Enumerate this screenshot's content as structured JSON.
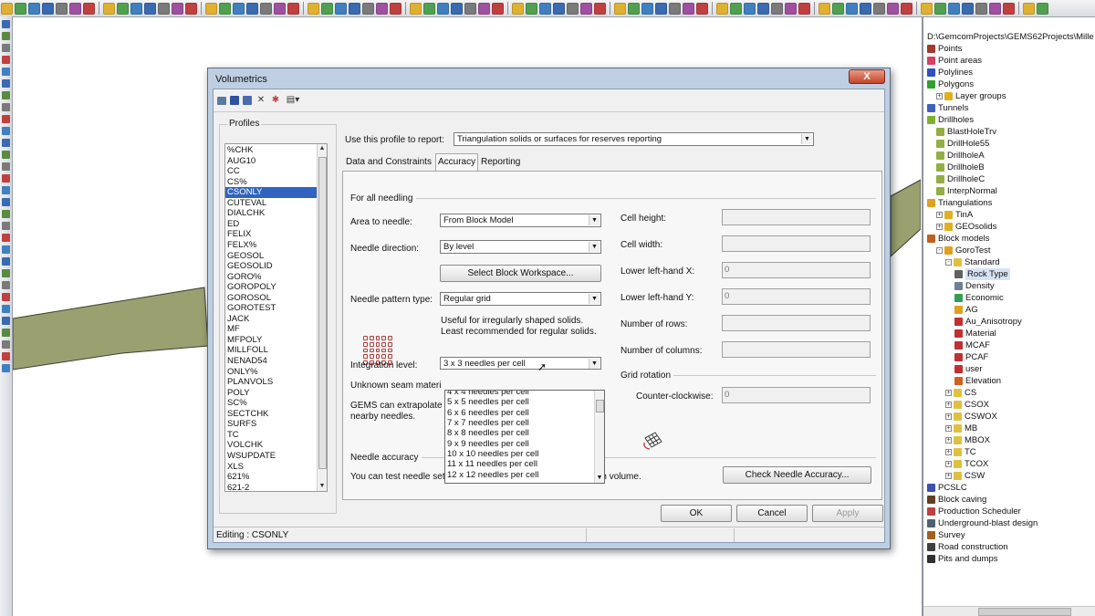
{
  "workspace": {
    "colors": {
      "surface_fill": "#9aa070",
      "surface_edge": "#3a4030"
    }
  },
  "right_panel": {
    "path": "D:\\GemcomProjects\\GEMS62Projects\\Mille",
    "tree": [
      {
        "label": "Points",
        "depth": 0,
        "icon": "points-icon",
        "color": "#a23a2a"
      },
      {
        "label": "Point areas",
        "depth": 0,
        "icon": "point-areas-icon",
        "color": "#d84060"
      },
      {
        "label": "Polylines",
        "depth": 0,
        "icon": "polylines-icon",
        "color": "#3050c0"
      },
      {
        "label": "Polygons",
        "depth": 0,
        "icon": "polygons-icon",
        "color": "#30a030"
      },
      {
        "label": "Layer groups",
        "depth": 1,
        "icon": "folder-icon",
        "color": "#e0b020",
        "expander": "+"
      },
      {
        "label": "Tunnels",
        "depth": 0,
        "icon": "tunnels-icon",
        "color": "#4060c0"
      },
      {
        "label": "Drillholes",
        "depth": 0,
        "icon": "drillholes-icon",
        "color": "#80b030"
      },
      {
        "label": "BlastHoleTrv",
        "depth": 1,
        "icon": "drillhole-table-icon",
        "color": "#90b040"
      },
      {
        "label": "DrillHole55",
        "depth": 1,
        "icon": "drillhole-table-icon",
        "color": "#90b040"
      },
      {
        "label": "DrillholeA",
        "depth": 1,
        "icon": "drillhole-table-icon",
        "color": "#90b040"
      },
      {
        "label": "DrillholeB",
        "depth": 1,
        "icon": "drillhole-table-icon",
        "color": "#90b040"
      },
      {
        "label": "DrillholeC",
        "depth": 1,
        "icon": "drillhole-table-icon",
        "color": "#90b040"
      },
      {
        "label": "InterpNormal",
        "depth": 1,
        "icon": "drillhole-table-icon",
        "color": "#90b040"
      },
      {
        "label": "Triangulations",
        "depth": 0,
        "icon": "triangulations-icon",
        "color": "#e0a020"
      },
      {
        "label": "TinA",
        "depth": 1,
        "icon": "folder-icon",
        "color": "#e0b020",
        "expander": "+"
      },
      {
        "label": "GEOsolids",
        "depth": 1,
        "icon": "folder-icon",
        "color": "#e0b020",
        "expander": "+"
      },
      {
        "label": "Block models",
        "depth": 0,
        "icon": "block-models-icon",
        "color": "#c06020"
      },
      {
        "label": "GoroTest",
        "depth": 1,
        "icon": "block-model-icon",
        "color": "#e0a020",
        "expander": "-"
      },
      {
        "label": "Standard",
        "depth": 2,
        "icon": "folder-icon",
        "color": "#e0c040",
        "expander": "-"
      },
      {
        "label": "Rock Type",
        "depth": 3,
        "icon": "rock-type-icon",
        "color": "#606060",
        "selected": true
      },
      {
        "label": "Density",
        "depth": 3,
        "icon": "density-icon",
        "color": "#708090"
      },
      {
        "label": "Economic",
        "depth": 3,
        "icon": "economic-icon",
        "color": "#30a050"
      },
      {
        "label": "AG",
        "depth": 3,
        "icon": "pencil-icon",
        "color": "#e0a020"
      },
      {
        "label": "Au_Anisotropy",
        "depth": 3,
        "icon": "attribute-icon",
        "color": "#c03030"
      },
      {
        "label": "Material",
        "depth": 3,
        "icon": "attribute-icon",
        "color": "#c03030"
      },
      {
        "label": "MCAF",
        "depth": 3,
        "icon": "attribute-icon",
        "color": "#c03030"
      },
      {
        "label": "PCAF",
        "depth": 3,
        "icon": "attribute-icon",
        "color": "#c03030"
      },
      {
        "label": "user",
        "depth": 3,
        "icon": "attribute-icon",
        "color": "#c03030"
      },
      {
        "label": "Elevation",
        "depth": 3,
        "icon": "elevation-icon",
        "color": "#d06020"
      },
      {
        "label": "CS",
        "depth": 2,
        "icon": "folder-icon",
        "color": "#e0c040",
        "expander": "+"
      },
      {
        "label": "CSOX",
        "depth": 2,
        "icon": "folder-icon",
        "color": "#e0c040",
        "expander": "+"
      },
      {
        "label": "CSWOX",
        "depth": 2,
        "icon": "folder-icon",
        "color": "#e0c040",
        "expander": "+"
      },
      {
        "label": "MB",
        "depth": 2,
        "icon": "folder-icon",
        "color": "#e0c040",
        "expander": "+"
      },
      {
        "label": "MBOX",
        "depth": 2,
        "icon": "folder-icon",
        "color": "#e0c040",
        "expander": "+"
      },
      {
        "label": "TC",
        "depth": 2,
        "icon": "folder-icon",
        "color": "#e0c040",
        "expander": "+"
      },
      {
        "label": "TCOX",
        "depth": 2,
        "icon": "folder-icon",
        "color": "#e0c040",
        "expander": "+"
      },
      {
        "label": "CSW",
        "depth": 2,
        "icon": "folder-icon",
        "color": "#e0c040",
        "expander": "+"
      },
      {
        "label": "PCSLC",
        "depth": 0,
        "icon": "pcslc-icon",
        "color": "#4050b0"
      },
      {
        "label": "Block caving",
        "depth": 0,
        "icon": "block-caving-icon",
        "color": "#604020"
      },
      {
        "label": "Production Scheduler",
        "depth": 0,
        "icon": "scheduler-icon",
        "color": "#c04040"
      },
      {
        "label": "Underground-blast design",
        "depth": 0,
        "icon": "blast-design-icon",
        "color": "#506070"
      },
      {
        "label": "Survey",
        "depth": 0,
        "icon": "survey-icon",
        "color": "#a06020"
      },
      {
        "label": "Road construction",
        "depth": 0,
        "icon": "road-icon",
        "color": "#404040"
      },
      {
        "label": "Pits and dumps",
        "depth": 0,
        "icon": "pits-icon",
        "color": "#303030"
      }
    ]
  },
  "dialog": {
    "title": "Volumetrics",
    "close_label": "X",
    "profiles": {
      "legend": "Profiles",
      "items": [
        "%CHK",
        "AUG10",
        "CC",
        "CS%",
        "CSONLY",
        "CUTEVAL",
        "DIALCHK",
        "ED",
        "FELIX",
        "FELX%",
        "GEOSOL",
        "GEOSOLID",
        "GORO%",
        "GOROPOLY",
        "GOROSOL",
        "GOROTEST",
        "JACK",
        "MF",
        "MFPOLY",
        "MILLFOLL",
        "NENAD54",
        "ONLY%",
        "PLANVOLS",
        "POLY",
        "SC%",
        "SECTCHK",
        "SURFS",
        "TC",
        "VOLCHK",
        "WSUPDATE",
        "XLS",
        "621%",
        "621-2"
      ],
      "selected_index": 4
    },
    "use_profile": {
      "label": "Use this profile to report:",
      "value": "Triangulation solids or surfaces for reserves reporting"
    },
    "tabs": [
      {
        "label": "Data and Constraints",
        "active": false
      },
      {
        "label": "Accuracy",
        "active": true
      },
      {
        "label": "Reporting",
        "active": false
      }
    ],
    "accuracy": {
      "section_title": "For all needling",
      "area_to_needle": {
        "label": "Area to needle:",
        "value": "From Block Model"
      },
      "needle_direction": {
        "label": "Needle direction:",
        "value": "By level"
      },
      "select_workspace_label": "Select Block Workspace...",
      "needle_pattern": {
        "label": "Needle pattern type:",
        "value": "Regular grid"
      },
      "pattern_note_1": "Useful for irregularly shaped solids.",
      "pattern_note_2": "Least recommended for regular solids.",
      "integration_level": {
        "label": "Integration level:",
        "value": "3 x  3 needles per cell"
      },
      "integration_options": [
        "4 x  4 needles per cell",
        "5 x  5 needles per cell",
        "6 x  6 needles per cell",
        "7 x  7 needles per cell",
        "8 x  8 needles per cell",
        "9 x  9 needles per cell",
        "10 x 10 needles per cell",
        "11 x 11 needles per cell",
        "12 x 12 needles per cell"
      ],
      "unknown_seam": "Unknown seam materi",
      "gems_extrapolate_1": "GEMS can extrapolate",
      "gems_extrapolate_2": "nearby needles.",
      "needle_accuracy_title": "Needle accuracy",
      "needle_accuracy_note": "You can test needle settings and compare the result to a known volume.",
      "check_button": "Check Needle Accuracy...",
      "cell_height": {
        "label": "Cell height:",
        "value": ""
      },
      "cell_width": {
        "label": "Cell width:",
        "value": ""
      },
      "lower_left_x": {
        "label": "Lower left-hand X:",
        "value": "0"
      },
      "lower_left_y": {
        "label": "Lower left-hand Y:",
        "value": "0"
      },
      "rows": {
        "label": "Number of rows:",
        "value": ""
      },
      "columns": {
        "label": "Number of columns:",
        "value": ""
      },
      "grid_rotation_title": "Grid rotation",
      "counter_clockwise": {
        "label": "Counter-clockwise:",
        "value": "0"
      }
    },
    "buttons": {
      "ok": "OK",
      "cancel": "Cancel",
      "apply": "Apply"
    },
    "status": "Editing : CSONLY"
  }
}
